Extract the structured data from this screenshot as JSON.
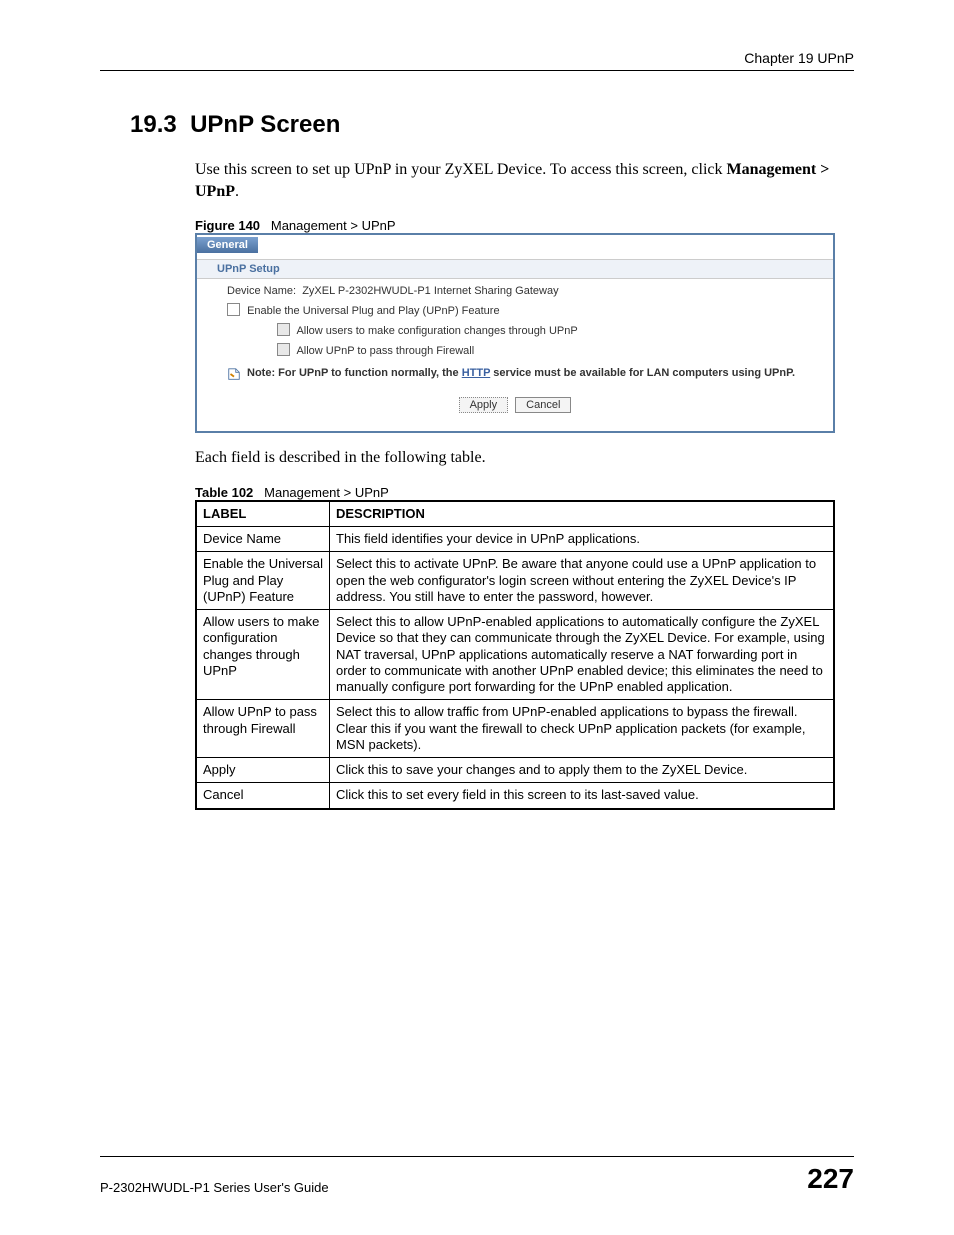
{
  "header": {
    "chapter": "Chapter 19 UPnP"
  },
  "section": {
    "number": "19.3",
    "title": "UPnP Screen"
  },
  "intro": {
    "line1": "Use this screen to set up UPnP in your ZyXEL Device. To access this screen, click ",
    "bold_path": "Management > UPnP",
    "period": "."
  },
  "figure": {
    "prefix": "Figure 140",
    "caption": "Management > UPnP",
    "tab": "General",
    "section_header": "UPnP Setup",
    "device_name_label": "Device Name:",
    "device_name_value": "ZyXEL P-2302HWUDL-P1 Internet Sharing Gateway",
    "cb_enable": "Enable the Universal Plug and Play (UPnP) Feature",
    "cb_allow_config": "Allow users to make configuration changes through UPnP",
    "cb_allow_firewall": "Allow UPnP to pass through Firewall",
    "note_prefix": "Note: For UPnP to function normally, the ",
    "note_link": "HTTP",
    "note_suffix": " service must be available for LAN computers using UPnP.",
    "apply_btn": "Apply",
    "cancel_btn": "Cancel"
  },
  "table_intro": "Each field is described in the following table.",
  "table_caption_prefix": "Table 102",
  "table_caption": "Management > UPnP",
  "table": {
    "head_label": "LABEL",
    "head_desc": "DESCRIPTION",
    "rows": [
      {
        "label": "Device Name",
        "desc": "This field identifies your device in UPnP applications."
      },
      {
        "label": "Enable the Universal Plug and Play (UPnP) Feature",
        "desc": "Select this to activate UPnP. Be aware that anyone could use a UPnP application to open the web configurator's login screen without entering the ZyXEL Device's IP address. You still have to enter the password, however."
      },
      {
        "label": "Allow users to make configuration changes through UPnP",
        "desc": "Select this to allow UPnP-enabled applications to automatically configure the ZyXEL Device so that they can communicate through the ZyXEL Device. For example, using NAT traversal, UPnP applications automatically reserve a NAT forwarding port in order to communicate with another UPnP enabled device; this eliminates the need to manually configure port forwarding for the UPnP enabled application."
      },
      {
        "label": "Allow UPnP to pass through Firewall",
        "desc": "Select this to allow traffic from UPnP-enabled applications to bypass the firewall. Clear this if you want the firewall to check UPnP application packets (for example, MSN packets)."
      },
      {
        "label": "Apply",
        "desc": "Click this to save your changes and to apply them to the ZyXEL Device."
      },
      {
        "label": "Cancel",
        "desc": "Click this to set every field in this screen to its last-saved value."
      }
    ]
  },
  "footer": {
    "guide": "P-2302HWUDL-P1 Series User's Guide",
    "page": "227"
  }
}
